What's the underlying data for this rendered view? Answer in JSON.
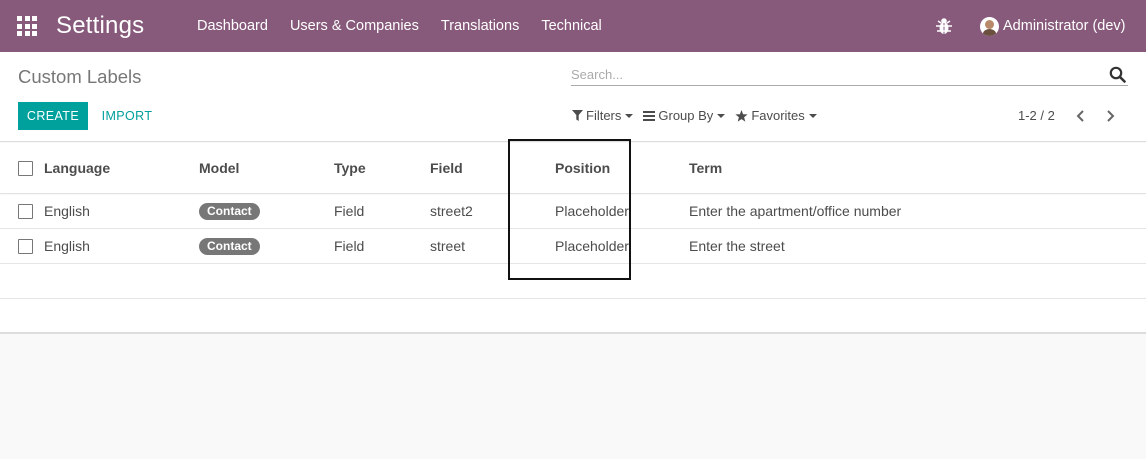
{
  "navbar": {
    "app_title": "Settings",
    "menu": [
      "Dashboard",
      "Users & Companies",
      "Translations",
      "Technical"
    ],
    "user_name": "Administrator (dev)",
    "bg_color": "#875a7b"
  },
  "control_panel": {
    "breadcrumb": "Custom Labels",
    "search_placeholder": "Search...",
    "create_label": "CREATE",
    "import_label": "IMPORT",
    "filters_label": "Filters",
    "group_by_label": "Group By",
    "favorites_label": "Favorites",
    "pager_text": "1-2 / 2",
    "accent_color": "#00a09d"
  },
  "table": {
    "headers": [
      "Language",
      "Model",
      "Type",
      "Field",
      "Position",
      "Term"
    ],
    "rows": [
      {
        "language": "English",
        "model": "Contact",
        "type": "Field",
        "field": "street2",
        "position": "Placeholder",
        "term": "Enter the apartment/office number"
      },
      {
        "language": "English",
        "model": "Contact",
        "type": "Field",
        "field": "street",
        "position": "Placeholder",
        "term": "Enter the street"
      }
    ]
  }
}
